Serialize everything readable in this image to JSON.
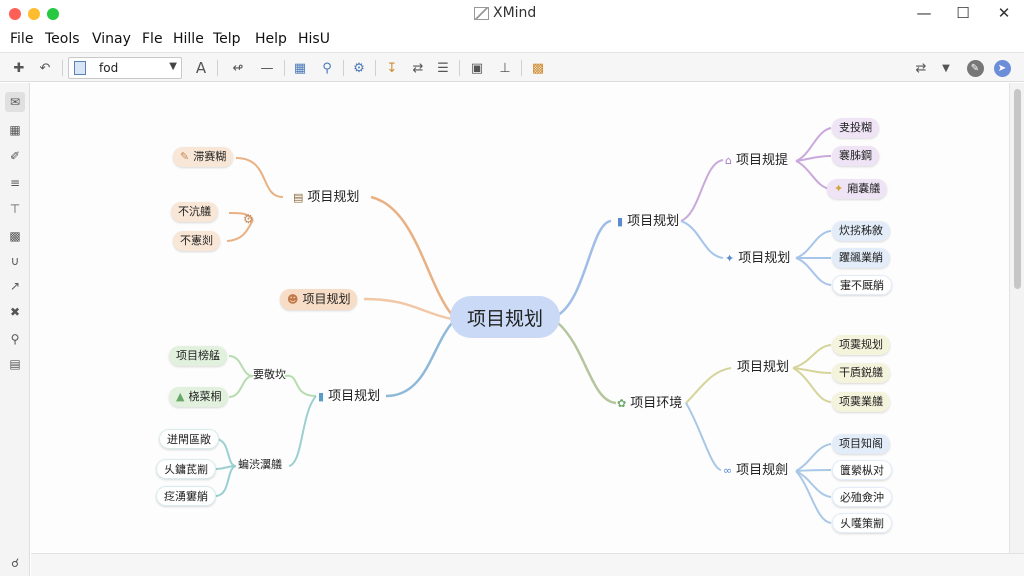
{
  "window": {
    "title": "XMind"
  },
  "menu": [
    "File",
    "Teols",
    "Vinay",
    "Fle",
    "Hille",
    "Telp",
    "Help",
    "HisU"
  ],
  "toolbar": {
    "font_value": "fod",
    "font_button": "A"
  },
  "map": {
    "central": "项目规划",
    "left": {
      "top_branch": {
        "label": "项目规划",
        "color": "#e9b183",
        "children": [
          "滞赛糊",
          "不沆艤",
          "不憲剡"
        ]
      },
      "mid_branch": {
        "label": "项目规划",
        "color": "#f0c8a8"
      },
      "bottom_branch": {
        "label": "项目规划",
        "color": "#8fb9d8",
        "sub_green": {
          "label": "要敬坎",
          "color": "#b6dcb0",
          "children": [
            "项目榜艋",
            "桡菜桐"
          ]
        },
        "sub_teal": {
          "label": "蝙渋瀷艤",
          "color": "#9ccfd0",
          "children": [
            "迸閈區敞",
            "乆鏞茋剬",
            "疺湧窶艄"
          ]
        }
      }
    },
    "right": {
      "top_branch": {
        "label": "项目规划",
        "color": "#9fbde6",
        "sub_purple": {
          "label": "项目规提",
          "color": "#c9a9db",
          "children": [
            "叏投糊",
            "褰胏鋼",
            "廂嚢艤"
          ]
        },
        "sub_blue": {
          "label": "项目规划",
          "color": "#a7c5ea",
          "children": [
            "炊挘秭敘",
            "躩飊業艄",
            "寁不厩艄"
          ]
        }
      },
      "bottom_branch": {
        "label": "项目环境",
        "color": "#b5c59d",
        "sub_olive": {
          "label": "项目规划",
          "color": "#d6d49a",
          "children": [
            "项霙规划",
            "干貭鋭艤",
            "项霙業艤"
          ]
        },
        "sub_blue": {
          "label": "项目规劍",
          "color": "#a9c8e6",
          "children": [
            "项目知阁",
            "籄縈枞对",
            "必殈僉沖",
            "乆嚄策剬"
          ]
        }
      }
    }
  }
}
